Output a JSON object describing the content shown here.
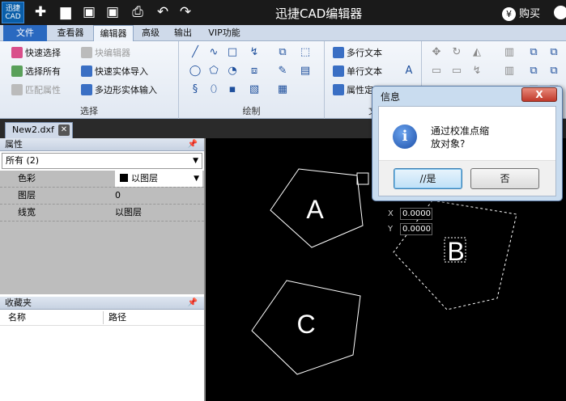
{
  "title_bar": {
    "logo_text": "迅捷\nCAD",
    "app_title": "迅捷CAD编辑器",
    "buy_label": "购买",
    "buy_icon": "yen-coin-icon"
  },
  "menu_tabs": [
    "文件",
    "查看器",
    "编辑器",
    "高级",
    "输出",
    "VIP功能"
  ],
  "active_tab": "编辑器",
  "ribbon": {
    "select_group": {
      "label": "选择",
      "quick_select": "快速选择",
      "select_all": "选择所有",
      "match_props": "匹配属性",
      "block_editor": "块编辑器",
      "quick_import": "快速实体导入",
      "polygon_import": "多边形实体输入"
    },
    "draw_group": {
      "label": "绘制"
    },
    "text_group": {
      "label": "文",
      "mtext": "多行文本",
      "stext": "单行文本",
      "attr": "属性定"
    }
  },
  "doc_tab": {
    "name": "New2.dxf"
  },
  "properties_panel": {
    "title": "属性",
    "filter_value": "所有 (2)",
    "rows": [
      {
        "key": "色彩",
        "value": "以图层",
        "swatch": "#000000"
      },
      {
        "key": "图层",
        "value": "0"
      },
      {
        "key": "线宽",
        "value": "以图层"
      }
    ]
  },
  "favorites_panel": {
    "title": "收藏夹",
    "columns": [
      "名称",
      "路径"
    ]
  },
  "canvas": {
    "shape_labels": [
      "A",
      "B",
      "C"
    ],
    "coord_x_label": "X",
    "coord_y_label": "Y",
    "coord_x_value": "0.0000",
    "coord_y_value": "0.0000"
  },
  "dialog": {
    "title": "信息",
    "close_label": "X",
    "message_line1": "通过校准点缩",
    "message_line2": "放对象?",
    "yes_label": "//是",
    "no_label": "否"
  }
}
